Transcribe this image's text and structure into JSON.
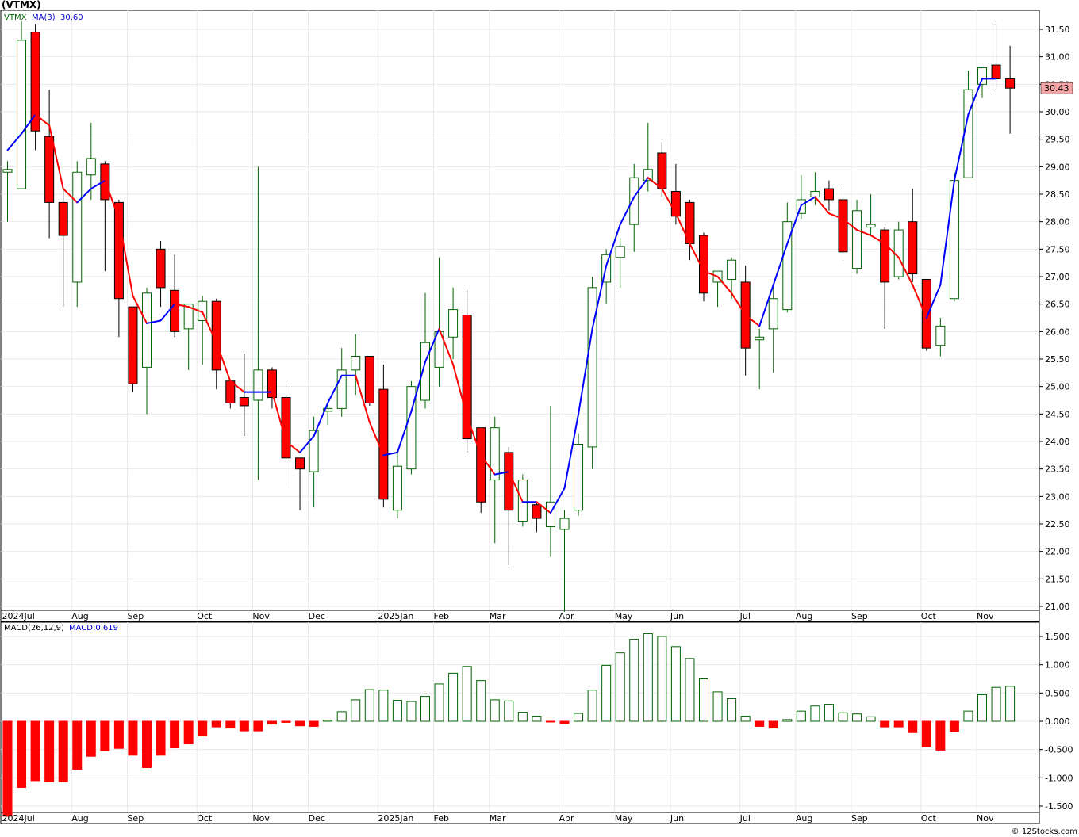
{
  "header": {
    "symbol": "(VTMX)"
  },
  "price_legend": {
    "ticker": "VTMX",
    "ma_label": "MA(3)",
    "ma_value": "30.60"
  },
  "macd_legend": {
    "label": "MACD(26,12,9)",
    "value_label": "MACD:0.619"
  },
  "last_price_label": "30.43",
  "watermark": "© 12Stocks.com",
  "colors": {
    "up": "#006400",
    "down": "#ff0000",
    "ma_up": "#0000ff",
    "ma_down": "#ff0000",
    "grid": "#e8e8e8",
    "last_price_bg": "#f4a6a6"
  },
  "month_labels": [
    {
      "label": "2024Jul",
      "week": 0
    },
    {
      "label": "Aug",
      "week": 5
    },
    {
      "label": "Sep",
      "week": 9
    },
    {
      "label": "Oct",
      "week": 14
    },
    {
      "label": "Nov",
      "week": 18
    },
    {
      "label": "Dec",
      "week": 22
    },
    {
      "label": "2025Jan",
      "week": 27
    },
    {
      "label": "Feb",
      "week": 31
    },
    {
      "label": "Mar",
      "week": 35
    },
    {
      "label": "Apr",
      "week": 40
    },
    {
      "label": "May",
      "week": 44
    },
    {
      "label": "Jun",
      "week": 48
    },
    {
      "label": "Jul",
      "week": 53
    },
    {
      "label": "Aug",
      "week": 57
    },
    {
      "label": "Sep",
      "week": 61
    },
    {
      "label": "Oct",
      "week": 66
    },
    {
      "label": "Nov",
      "week": 70
    }
  ],
  "price_ticks": [
    "31.50",
    "31.00",
    "30.50",
    "30.00",
    "29.50",
    "29.00",
    "28.50",
    "28.00",
    "27.50",
    "27.00",
    "26.50",
    "26.00",
    "25.50",
    "25.00",
    "24.50",
    "24.00",
    "23.50",
    "23.00",
    "22.50",
    "22.00",
    "21.50",
    "21.00"
  ],
  "macd_ticks": [
    "1.500",
    "1.000",
    "0.500",
    "0.000",
    "-0.500",
    "-1.000",
    "-1.500"
  ],
  "chart_data": [
    {
      "type": "candlestick",
      "title": "(VTMX)",
      "ylim": [
        20.8,
        31.8
      ],
      "candles": [
        {
          "o": 28.9,
          "h": 29.1,
          "l": 28.0,
          "c": 28.95
        },
        {
          "o": 28.6,
          "h": 31.65,
          "l": 28.6,
          "c": 31.3
        },
        {
          "o": 31.45,
          "h": 31.6,
          "l": 29.3,
          "c": 29.65
        },
        {
          "o": 29.55,
          "h": 30.4,
          "l": 27.7,
          "c": 28.35
        },
        {
          "o": 28.35,
          "h": 28.6,
          "l": 26.45,
          "c": 27.75
        },
        {
          "o": 26.9,
          "h": 29.1,
          "l": 26.45,
          "c": 28.9
        },
        {
          "o": 28.85,
          "h": 29.8,
          "l": 28.4,
          "c": 29.15
        },
        {
          "o": 29.05,
          "h": 29.1,
          "l": 27.1,
          "c": 28.4
        },
        {
          "o": 28.35,
          "h": 28.4,
          "l": 25.9,
          "c": 26.6
        },
        {
          "o": 26.45,
          "h": 26.45,
          "l": 24.9,
          "c": 25.05
        },
        {
          "o": 25.35,
          "h": 26.8,
          "l": 24.5,
          "c": 26.7
        },
        {
          "o": 27.5,
          "h": 27.65,
          "l": 26.45,
          "c": 26.8
        },
        {
          "o": 26.75,
          "h": 27.4,
          "l": 25.9,
          "c": 26.0
        },
        {
          "o": 26.05,
          "h": 26.5,
          "l": 25.3,
          "c": 26.5
        },
        {
          "o": 26.2,
          "h": 26.65,
          "l": 25.4,
          "c": 26.55
        },
        {
          "o": 26.55,
          "h": 26.6,
          "l": 24.95,
          "c": 25.3
        },
        {
          "o": 25.1,
          "h": 25.1,
          "l": 24.6,
          "c": 24.7
        },
        {
          "o": 24.8,
          "h": 25.6,
          "l": 24.1,
          "c": 24.65
        },
        {
          "o": 24.75,
          "h": 29.0,
          "l": 23.3,
          "c": 25.3
        },
        {
          "o": 25.3,
          "h": 25.35,
          "l": 24.6,
          "c": 24.8
        },
        {
          "o": 24.8,
          "h": 25.1,
          "l": 23.15,
          "c": 23.7
        },
        {
          "o": 23.7,
          "h": 23.7,
          "l": 22.75,
          "c": 23.5
        },
        {
          "o": 23.45,
          "h": 24.45,
          "l": 22.8,
          "c": 24.2
        },
        {
          "o": 24.55,
          "h": 24.7,
          "l": 24.3,
          "c": 24.6
        },
        {
          "o": 24.6,
          "h": 25.7,
          "l": 24.45,
          "c": 25.3
        },
        {
          "o": 25.3,
          "h": 25.95,
          "l": 24.85,
          "c": 25.55
        },
        {
          "o": 25.55,
          "h": 25.55,
          "l": 24.65,
          "c": 24.7
        },
        {
          "o": 24.95,
          "h": 25.4,
          "l": 22.8,
          "c": 22.95
        },
        {
          "o": 22.75,
          "h": 23.8,
          "l": 22.6,
          "c": 23.55
        },
        {
          "o": 23.5,
          "h": 25.1,
          "l": 23.4,
          "c": 25.0
        },
        {
          "o": 24.75,
          "h": 26.7,
          "l": 24.6,
          "c": 25.8
        },
        {
          "o": 25.35,
          "h": 27.35,
          "l": 25.0,
          "c": 26.0
        },
        {
          "o": 25.9,
          "h": 26.8,
          "l": 25.5,
          "c": 26.4
        },
        {
          "o": 26.3,
          "h": 26.75,
          "l": 23.8,
          "c": 24.05
        },
        {
          "o": 24.25,
          "h": 24.25,
          "l": 22.7,
          "c": 22.9
        },
        {
          "o": 23.3,
          "h": 24.45,
          "l": 22.15,
          "c": 24.25
        },
        {
          "o": 23.8,
          "h": 23.9,
          "l": 21.75,
          "c": 22.75
        },
        {
          "o": 22.55,
          "h": 23.4,
          "l": 22.45,
          "c": 23.3
        },
        {
          "o": 22.85,
          "h": 22.9,
          "l": 22.35,
          "c": 22.6
        },
        {
          "o": 22.45,
          "h": 24.65,
          "l": 21.9,
          "c": 22.9
        },
        {
          "o": 22.4,
          "h": 22.75,
          "l": 20.9,
          "c": 22.6
        },
        {
          "o": 22.75,
          "h": 24.15,
          "l": 22.65,
          "c": 23.95
        },
        {
          "o": 23.9,
          "h": 27.0,
          "l": 23.5,
          "c": 26.8
        },
        {
          "o": 26.9,
          "h": 27.5,
          "l": 26.5,
          "c": 27.4
        },
        {
          "o": 27.35,
          "h": 27.7,
          "l": 26.8,
          "c": 27.55
        },
        {
          "o": 27.95,
          "h": 29.05,
          "l": 27.45,
          "c": 28.8
        },
        {
          "o": 28.75,
          "h": 29.8,
          "l": 28.55,
          "c": 28.95
        },
        {
          "o": 29.25,
          "h": 29.45,
          "l": 28.45,
          "c": 28.6
        },
        {
          "o": 28.55,
          "h": 29.05,
          "l": 27.95,
          "c": 28.1
        },
        {
          "o": 28.35,
          "h": 28.4,
          "l": 27.3,
          "c": 27.6
        },
        {
          "o": 27.75,
          "h": 27.8,
          "l": 26.55,
          "c": 26.7
        },
        {
          "o": 26.9,
          "h": 27.1,
          "l": 26.45,
          "c": 27.1
        },
        {
          "o": 26.95,
          "h": 27.35,
          "l": 26.6,
          "c": 27.3
        },
        {
          "o": 26.9,
          "h": 27.2,
          "l": 25.2,
          "c": 25.7
        },
        {
          "o": 25.85,
          "h": 26.05,
          "l": 24.95,
          "c": 25.9
        },
        {
          "o": 26.05,
          "h": 26.8,
          "l": 25.25,
          "c": 26.6
        },
        {
          "o": 26.4,
          "h": 28.35,
          "l": 26.35,
          "c": 28.0
        },
        {
          "o": 28.15,
          "h": 28.85,
          "l": 28.05,
          "c": 28.4
        },
        {
          "o": 28.45,
          "h": 28.9,
          "l": 28.3,
          "c": 28.55
        },
        {
          "o": 28.6,
          "h": 28.75,
          "l": 28.2,
          "c": 28.4
        },
        {
          "o": 28.4,
          "h": 28.6,
          "l": 27.3,
          "c": 27.45
        },
        {
          "o": 27.15,
          "h": 28.4,
          "l": 27.05,
          "c": 28.2
        },
        {
          "o": 27.9,
          "h": 28.5,
          "l": 27.75,
          "c": 27.95
        },
        {
          "o": 27.85,
          "h": 27.9,
          "l": 26.05,
          "c": 26.9
        },
        {
          "o": 27.0,
          "h": 28.0,
          "l": 26.95,
          "c": 27.85
        },
        {
          "o": 28.0,
          "h": 28.6,
          "l": 26.9,
          "c": 27.05
        },
        {
          "o": 26.95,
          "h": 26.95,
          "l": 25.65,
          "c": 25.7
        },
        {
          "o": 25.75,
          "h": 26.25,
          "l": 25.55,
          "c": 26.1
        },
        {
          "o": 26.6,
          "h": 28.9,
          "l": 26.55,
          "c": 28.75
        },
        {
          "o": 28.8,
          "h": 30.75,
          "l": 28.8,
          "c": 30.4
        },
        {
          "o": 30.5,
          "h": 30.8,
          "l": 30.25,
          "c": 30.8
        },
        {
          "o": 30.85,
          "h": 31.6,
          "l": 30.4,
          "c": 30.6
        },
        {
          "o": 30.6,
          "h": 31.2,
          "l": 29.6,
          "c": 30.43
        }
      ],
      "ma_period": 3,
      "ma": [
        29.3,
        29.6,
        29.95,
        29.75,
        28.6,
        28.35,
        28.6,
        28.75,
        28.05,
        26.65,
        26.15,
        26.2,
        26.5,
        26.45,
        26.35,
        25.8,
        25.1,
        24.9,
        24.9,
        24.9,
        24.0,
        23.8,
        24.1,
        24.7,
        25.2,
        25.2,
        24.35,
        23.75,
        23.8,
        24.55,
        25.45,
        26.05,
        25.4,
        24.45,
        23.75,
        23.4,
        23.45,
        22.9,
        22.9,
        22.7,
        23.15,
        24.5,
        26.05,
        27.2,
        27.95,
        28.45,
        28.8,
        28.6,
        28.15,
        27.6,
        27.1,
        27.0,
        26.7,
        26.3,
        26.1,
        26.85,
        27.6,
        28.3,
        28.45,
        28.15,
        28.05,
        27.85,
        27.75,
        27.6,
        27.35,
        26.85,
        26.25,
        26.85,
        28.75,
        29.95,
        30.6,
        30.6
      ],
      "last_value": 30.43
    },
    {
      "type": "bar",
      "title": "MACD(26,12,9)",
      "ylim": [
        -1.65,
        1.7
      ],
      "values": [
        -1.68,
        -1.17,
        -1.05,
        -1.07,
        -1.07,
        -0.85,
        -0.62,
        -0.52,
        -0.48,
        -0.6,
        -0.82,
        -0.6,
        -0.47,
        -0.4,
        -0.26,
        -0.1,
        -0.12,
        -0.17,
        -0.17,
        -0.05,
        -0.02,
        -0.08,
        -0.09,
        0.02,
        0.17,
        0.38,
        0.56,
        0.55,
        0.37,
        0.35,
        0.44,
        0.66,
        0.85,
        0.97,
        0.72,
        0.38,
        0.36,
        0.16,
        0.09,
        -0.01,
        -0.04,
        0.14,
        0.55,
        0.99,
        1.21,
        1.45,
        1.55,
        1.5,
        1.32,
        1.11,
        0.75,
        0.52,
        0.4,
        0.09,
        -0.09,
        -0.12,
        0.03,
        0.18,
        0.27,
        0.3,
        0.15,
        0.13,
        0.08,
        -0.1,
        -0.1,
        -0.2,
        -0.45,
        -0.51,
        -0.18,
        0.18,
        0.47,
        0.6,
        0.619
      ],
      "last_value": 0.619
    }
  ]
}
